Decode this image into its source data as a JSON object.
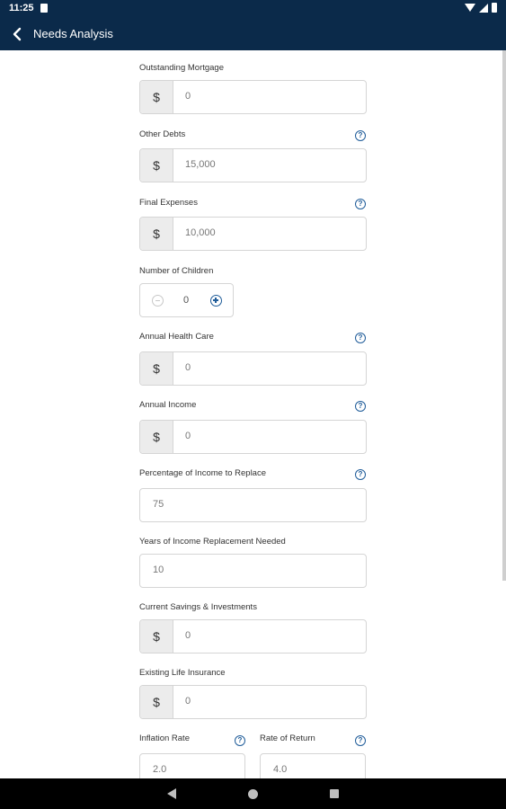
{
  "status": {
    "time": "11:25"
  },
  "header": {
    "title": "Needs Analysis"
  },
  "icons": {
    "back": "chevron-left-icon",
    "help": "question-circle-icon",
    "minus": "minus-circle-icon",
    "plus": "plus-circle-icon"
  },
  "colors": {
    "app_bar": "#0b2a4a",
    "accent": "#1f5c99"
  },
  "currency_symbol": "$",
  "help_glyph": "?",
  "form": {
    "outstanding_mortgage": {
      "label": "Outstanding Mortgage",
      "value": "0"
    },
    "other_debts": {
      "label": "Other Debts",
      "value": "15,000"
    },
    "final_expenses": {
      "label": "Final Expenses",
      "value": "10,000"
    },
    "number_of_children": {
      "label": "Number of Children",
      "value": "0"
    },
    "annual_health_care": {
      "label": "Annual Health Care",
      "value": "0"
    },
    "annual_income": {
      "label": "Annual Income",
      "value": "0"
    },
    "percentage_income_replace": {
      "label": "Percentage of Income to Replace",
      "value": "75"
    },
    "years_income_replacement": {
      "label": "Years of Income Replacement Needed",
      "value": "10"
    },
    "current_savings": {
      "label": "Current Savings & Investments",
      "value": "0"
    },
    "existing_life_insurance": {
      "label": "Existing Life Insurance",
      "value": "0"
    },
    "inflation_rate": {
      "label": "Inflation Rate",
      "value": "2.0"
    },
    "rate_of_return": {
      "label": "Rate of Return",
      "value": "4.0"
    }
  }
}
